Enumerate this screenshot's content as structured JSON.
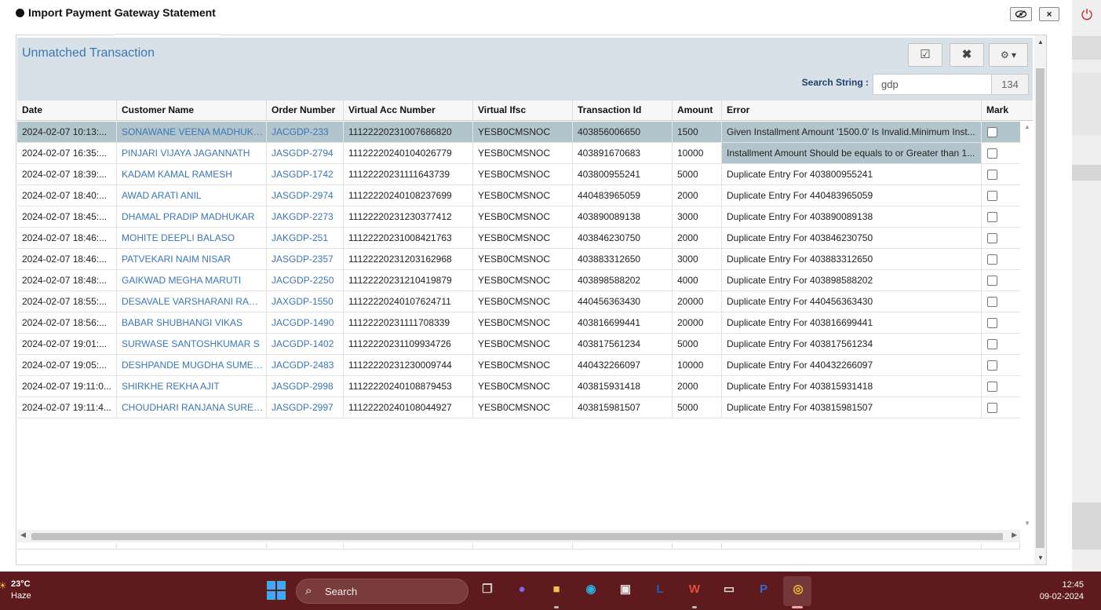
{
  "modal": {
    "title": "Import Payment Gateway Statement",
    "eye_icon": "eye-slash-icon",
    "close_label": "×"
  },
  "panel": {
    "title": "Unmatched Transaction",
    "toolbar": {
      "check_icon": "☑",
      "close_icon": "✖",
      "gear_icon": "⚙ ▾"
    },
    "search": {
      "label": "Search String :",
      "value": "gdp",
      "count": "134"
    }
  },
  "grid": {
    "columns": [
      "Date",
      "Customer Name",
      "Order Number",
      "Virtual Acc Number",
      "Virtual Ifsc",
      "Transaction Id",
      "Amount",
      "Error",
      "Mark"
    ],
    "rows": [
      {
        "date": "2024-02-07 10:13:...",
        "customer": "SONAWANE VEENA MADHUKAR",
        "order": "JACGDP-233",
        "vacc": "11122220231007686820",
        "ifsc": "YESB0CMSNOC",
        "txn": "403856006650",
        "amount": "1500",
        "error": "Given Installment Amount '1500.0' Is Invalid.Minimum Inst...",
        "selected": true,
        "err_hl": false
      },
      {
        "date": "2024-02-07 16:35:...",
        "customer": "PINJARI VIJAYA JAGANNATH",
        "order": "JASGDP-2794",
        "vacc": "11122220240104026779",
        "ifsc": "YESB0CMSNOC",
        "txn": "403891670683",
        "amount": "10000",
        "error": "Installment Amount Should be equals to or Greater than 1...",
        "selected": false,
        "err_hl": true
      },
      {
        "date": "2024-02-07 18:39:...",
        "customer": "KADAM KAMAL RAMESH",
        "order": "JASGDP-1742",
        "vacc": "11122220231111643739",
        "ifsc": "YESB0CMSNOC",
        "txn": "403800955241",
        "amount": "5000",
        "error": "Duplicate Entry For 403800955241",
        "selected": false,
        "err_hl": false
      },
      {
        "date": "2024-02-07 18:40:...",
        "customer": "AWAD ARATI ANIL",
        "order": "JASGDP-2974",
        "vacc": "11122220240108237699",
        "ifsc": "YESB0CMSNOC",
        "txn": "440483965059",
        "amount": "2000",
        "error": "Duplicate Entry For 440483965059",
        "selected": false,
        "err_hl": false
      },
      {
        "date": "2024-02-07 18:45:...",
        "customer": "DHAMAL PRADIP MADHUKAR",
        "order": "JAKGDP-2273",
        "vacc": "11122220231230377412",
        "ifsc": "YESB0CMSNOC",
        "txn": "403890089138",
        "amount": "3000",
        "error": "Duplicate Entry For 403890089138",
        "selected": false,
        "err_hl": false
      },
      {
        "date": "2024-02-07 18:46:...",
        "customer": "MOHITE DEEPLI BALASO",
        "order": "JAKGDP-251",
        "vacc": "11122220231008421763",
        "ifsc": "YESB0CMSNOC",
        "txn": "403846230750",
        "amount": "2000",
        "error": "Duplicate Entry For 403846230750",
        "selected": false,
        "err_hl": false
      },
      {
        "date": "2024-02-07 18:46:...",
        "customer": "PATVEKARI NAIM NISAR",
        "order": "JASGDP-2357",
        "vacc": "11122220231203162968",
        "ifsc": "YESB0CMSNOC",
        "txn": "403883312650",
        "amount": "3000",
        "error": "Duplicate Entry For 403883312650",
        "selected": false,
        "err_hl": false
      },
      {
        "date": "2024-02-07 18:48:...",
        "customer": "GAIKWAD MEGHA MARUTI",
        "order": "JACGDP-2250",
        "vacc": "11122220231210419879",
        "ifsc": "YESB0CMSNOC",
        "txn": "403898588202",
        "amount": "4000",
        "error": "Duplicate Entry For 403898588202",
        "selected": false,
        "err_hl": false
      },
      {
        "date": "2024-02-07 18:55:...",
        "customer": "DESAVALE VARSHARANI RAMCH",
        "order": "JAXGDP-1550",
        "vacc": "11122220240107624711",
        "ifsc": "YESB0CMSNOC",
        "txn": "440456363430",
        "amount": "20000",
        "error": "Duplicate Entry For 440456363430",
        "selected": false,
        "err_hl": false
      },
      {
        "date": "2024-02-07 18:56:...",
        "customer": "BABAR SHUBHANGI VIKAS",
        "order": "JACGDP-1490",
        "vacc": "11122220231111708339",
        "ifsc": "YESB0CMSNOC",
        "txn": "403816699441",
        "amount": "20000",
        "error": "Duplicate Entry For 403816699441",
        "selected": false,
        "err_hl": false
      },
      {
        "date": "2024-02-07 19:01:...",
        "customer": "SURWASE SANTOSHKUMAR S",
        "order": "JACGDP-1402",
        "vacc": "11122220231109934726",
        "ifsc": "YESB0CMSNOC",
        "txn": "403817561234",
        "amount": "5000",
        "error": "Duplicate Entry For 403817561234",
        "selected": false,
        "err_hl": false
      },
      {
        "date": "2024-02-07 19:05:...",
        "customer": "DESHPANDE MUGDHA SUMESH",
        "order": "JACGDP-2483",
        "vacc": "11122220231230009744",
        "ifsc": "YESB0CMSNOC",
        "txn": "440432266097",
        "amount": "10000",
        "error": "Duplicate Entry For 440432266097",
        "selected": false,
        "err_hl": false
      },
      {
        "date": "2024-02-07 19:11:0...",
        "customer": "SHIRKHE REKHA AJIT",
        "order": "JASGDP-2998",
        "vacc": "11122220240108879453",
        "ifsc": "YESB0CMSNOC",
        "txn": "403815931418",
        "amount": "2000",
        "error": "Duplicate Entry For 403815931418",
        "selected": false,
        "err_hl": false
      },
      {
        "date": "2024-02-07 19:11:4...",
        "customer": "CHOUDHARI RANJANA SURESH",
        "order": "JASGDP-2997",
        "vacc": "11122220240108044927",
        "ifsc": "YESB0CMSNOC",
        "txn": "403815981507",
        "amount": "5000",
        "error": "Duplicate Entry For 403815981507",
        "selected": false,
        "err_hl": false
      }
    ]
  },
  "taskbar": {
    "weather_temp": "23°C",
    "weather_cond": "Haze",
    "search_label": "Search",
    "time": "12:45",
    "date": "09-02-2024",
    "apps": [
      {
        "name": "task-view-icon",
        "glyph": "❐",
        "color": "#cfcfcf"
      },
      {
        "name": "chat-icon",
        "glyph": "●",
        "color": "#7b68ee"
      },
      {
        "name": "file-explorer-icon",
        "glyph": "■",
        "color": "#f2c14e"
      },
      {
        "name": "edge-icon",
        "glyph": "◉",
        "color": "#2bb0e6"
      },
      {
        "name": "store-icon",
        "glyph": "▣",
        "color": "#e8e8e8"
      },
      {
        "name": "l-app-icon",
        "glyph": "L",
        "color": "#1a5fb4"
      },
      {
        "name": "wps-office-icon",
        "glyph": "W",
        "color": "#e54a3c"
      },
      {
        "name": "window-app-icon",
        "glyph": "▭",
        "color": "#dddddd"
      },
      {
        "name": "p-app-icon",
        "glyph": "P",
        "color": "#2d6bd6"
      },
      {
        "name": "chrome-icon",
        "glyph": "◎",
        "color": "#f2c033"
      }
    ]
  }
}
